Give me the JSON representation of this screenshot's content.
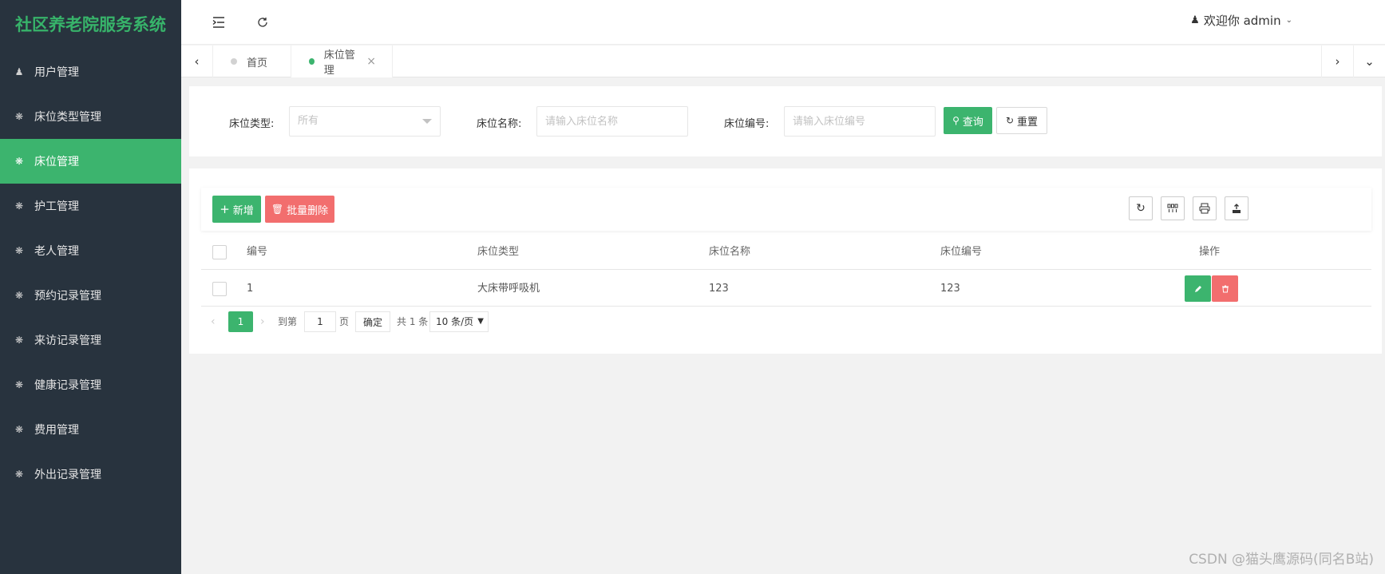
{
  "app": {
    "title": "社区养老院服务系统"
  },
  "sidebar": {
    "items": [
      {
        "label": "用户管理",
        "icon": "user-icon"
      },
      {
        "label": "床位类型管理",
        "icon": "gear-icon"
      },
      {
        "label": "床位管理",
        "icon": "gear-icon",
        "active": true
      },
      {
        "label": "护工管理",
        "icon": "gear-icon"
      },
      {
        "label": "老人管理",
        "icon": "gear-icon"
      },
      {
        "label": "预约记录管理",
        "icon": "gear-icon"
      },
      {
        "label": "来访记录管理",
        "icon": "gear-icon"
      },
      {
        "label": "健康记录管理",
        "icon": "gear-icon"
      },
      {
        "label": "费用管理",
        "icon": "gear-icon"
      },
      {
        "label": "外出记录管理",
        "icon": "gear-icon"
      }
    ]
  },
  "header": {
    "user_greeting": "欢迎你 admin"
  },
  "tabs": [
    {
      "label": "首页"
    },
    {
      "label": "床位管理",
      "active": true
    }
  ],
  "search": {
    "type_label": "床位类型:",
    "type_value": "所有",
    "name_label": "床位名称:",
    "name_placeholder": "请输入床位名称",
    "code_label": "床位编号:",
    "code_placeholder": "请输入床位编号",
    "query_button": "查询",
    "reset_button": "重置"
  },
  "toolbar": {
    "add_button": "新增",
    "batch_delete_button": "批量删除"
  },
  "table": {
    "columns": [
      "编号",
      "床位类型",
      "床位名称",
      "床位编号",
      "操作"
    ],
    "rows": [
      {
        "id": "1",
        "type": "大床带呼吸机",
        "name": "123",
        "code": "123"
      }
    ]
  },
  "pagination": {
    "current_page": "1",
    "goto_label": "到第",
    "goto_value": "1",
    "page_unit": "页",
    "confirm_button": "确定",
    "total_text": "共 1 条",
    "page_size": "10 条/页"
  },
  "watermark": "CSDN @猫头鹰源码(同名B站)",
  "colors": {
    "accent": "#3cb46e",
    "danger": "#f26e6e",
    "sidebar_bg": "#28333e"
  }
}
